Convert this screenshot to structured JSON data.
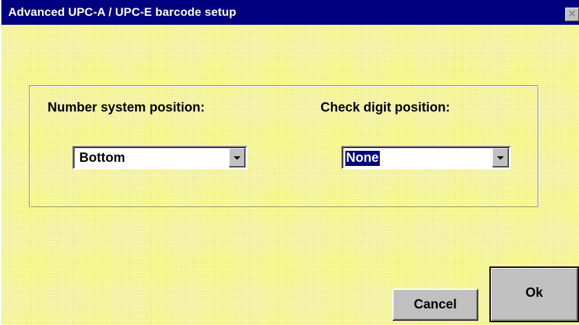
{
  "window": {
    "title": "Advanced UPC-A / UPC-E barcode setup",
    "close_glyph": "✕"
  },
  "fields": {
    "number_system": {
      "label": "Number system position:",
      "value": "Bottom"
    },
    "check_digit": {
      "label": "Check digit position:",
      "value": "None"
    }
  },
  "buttons": {
    "cancel_label": "Cancel",
    "ok_label": "Ok"
  },
  "icons": {
    "close": "close-icon",
    "dropdown": "chevron-down-icon"
  },
  "colors": {
    "titlebar": "#000080",
    "background": "#ffff99",
    "button_face": "#c0c0c0",
    "selection": "#000080"
  }
}
